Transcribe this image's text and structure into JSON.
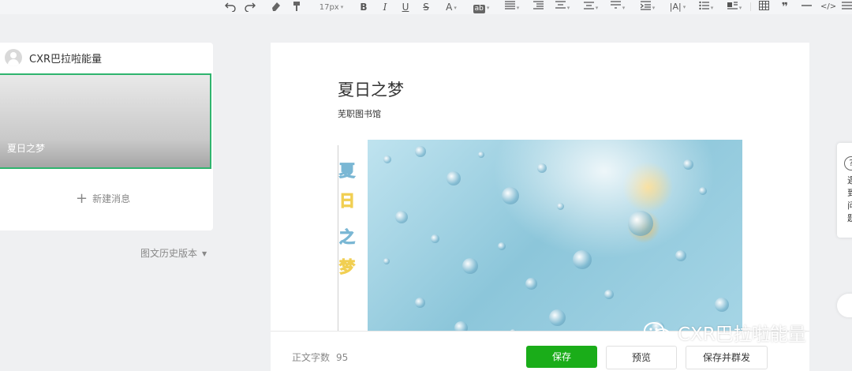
{
  "toolbar": {
    "undo_icon": "undo-icon",
    "redo_icon": "redo-icon",
    "font_size": "17px",
    "bold": "B",
    "italic": "I",
    "underline": "U",
    "strike": "S",
    "font_color": "A",
    "bg_color": "ab"
  },
  "sidebar": {
    "account_name": "CXR巴拉啦能量",
    "article_thumb_title": "夏日之梦",
    "new_message_label": "新建消息",
    "history_label": "图文历史版本"
  },
  "article": {
    "title": "夏日之梦",
    "author": "芜职图书馆",
    "vertical_title_chars": [
      "夏",
      "日",
      "之",
      "梦"
    ]
  },
  "bottom": {
    "word_count_label": "正文字数",
    "word_count_value": "95",
    "save_label": "保存",
    "preview_label": "预览",
    "save_mass_label": "保存并群发"
  },
  "help_panel": {
    "chars": [
      "遇",
      "到",
      "问",
      "题"
    ]
  },
  "watermark": {
    "text": "CXR巴拉啦能量"
  },
  "colors": {
    "accent_green": "#1aad19",
    "selected_border": "#2fb46e",
    "page_bg": "#eff0f2"
  }
}
